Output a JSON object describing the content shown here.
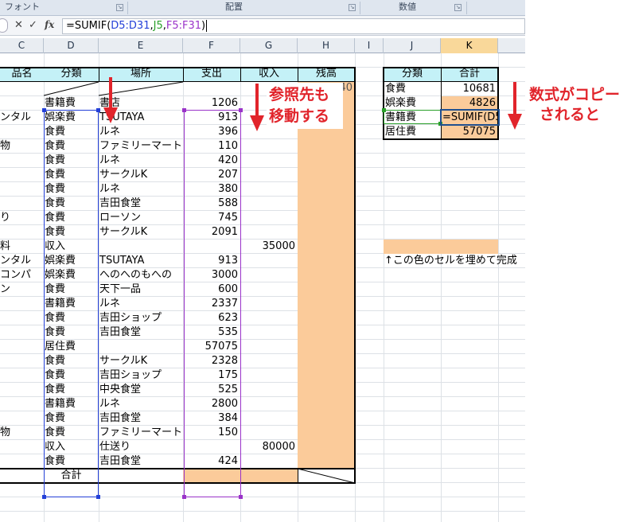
{
  "ribbon": {
    "groups": [
      {
        "label": "フォント"
      },
      {
        "label": "配置"
      },
      {
        "label": "数値"
      }
    ]
  },
  "formula_bar": {
    "cancel": "✕",
    "enter": "✓",
    "fx": "fx",
    "formula": {
      "prefix": "=SUMIF(",
      "arg1": "D5:D31",
      "sep1": ",",
      "arg2": "J5",
      "sep2": ",",
      "arg3": "F5:F31",
      "suffix": ")"
    }
  },
  "columns": [
    "C",
    "D",
    "E",
    "F",
    "G",
    "H",
    "I",
    "J",
    "K"
  ],
  "table": {
    "headers": [
      "品名",
      "分類",
      "場所",
      "支出",
      "収入",
      "残高"
    ],
    "balance_first": "75240",
    "rows": [
      {
        "name": "",
        "cat": "書籍費",
        "place": "書店",
        "out": "1206",
        "in": ""
      },
      {
        "name": "ンタル",
        "cat": "娯楽費",
        "place": "TSUTAYA",
        "out": "913",
        "in": ""
      },
      {
        "name": "",
        "cat": "食費",
        "place": "ルネ",
        "out": "396",
        "in": ""
      },
      {
        "name": "物",
        "cat": "食費",
        "place": "ファミリーマート",
        "out": "110",
        "in": ""
      },
      {
        "name": "",
        "cat": "食費",
        "place": "ルネ",
        "out": "420",
        "in": ""
      },
      {
        "name": "",
        "cat": "食費",
        "place": "サークルK",
        "out": "207",
        "in": ""
      },
      {
        "name": "",
        "cat": "食費",
        "place": "ルネ",
        "out": "380",
        "in": ""
      },
      {
        "name": "",
        "cat": "食費",
        "place": "吉田食堂",
        "out": "588",
        "in": ""
      },
      {
        "name": "り",
        "cat": "食費",
        "place": "ローソン",
        "out": "745",
        "in": ""
      },
      {
        "name": "",
        "cat": "食費",
        "place": "サークルK",
        "out": "2091",
        "in": ""
      },
      {
        "name": "料",
        "cat": "収入",
        "place": "",
        "out": "",
        "in": "35000"
      },
      {
        "name": "ンタル",
        "cat": "娯楽費",
        "place": "TSUTAYA",
        "out": "913",
        "in": ""
      },
      {
        "name": "コンパ",
        "cat": "娯楽費",
        "place": "へのへのもへの",
        "out": "3000",
        "in": ""
      },
      {
        "name": "ン",
        "cat": "食費",
        "place": "天下一品",
        "out": "600",
        "in": ""
      },
      {
        "name": "",
        "cat": "書籍費",
        "place": "ルネ",
        "out": "2337",
        "in": ""
      },
      {
        "name": "",
        "cat": "食費",
        "place": "吉田ショップ",
        "out": "623",
        "in": ""
      },
      {
        "name": "",
        "cat": "食費",
        "place": "吉田食堂",
        "out": "535",
        "in": ""
      },
      {
        "name": "",
        "cat": "居住費",
        "place": "",
        "out": "57075",
        "in": ""
      },
      {
        "name": "",
        "cat": "食費",
        "place": "サークルK",
        "out": "2328",
        "in": ""
      },
      {
        "name": "",
        "cat": "食費",
        "place": "吉田ショップ",
        "out": "175",
        "in": ""
      },
      {
        "name": "",
        "cat": "食費",
        "place": "中央食堂",
        "out": "525",
        "in": ""
      },
      {
        "name": "",
        "cat": "書籍費",
        "place": "ルネ",
        "out": "2800",
        "in": ""
      },
      {
        "name": "",
        "cat": "食費",
        "place": "吉田食堂",
        "out": "384",
        "in": ""
      },
      {
        "name": "物",
        "cat": "食費",
        "place": "ファミリーマート",
        "out": "150",
        "in": ""
      },
      {
        "name": "",
        "cat": "収入",
        "place": "仕送り",
        "out": "",
        "in": "80000"
      },
      {
        "name": "",
        "cat": "食費",
        "place": "吉田食堂",
        "out": "424",
        "in": ""
      }
    ],
    "total_label": "合計"
  },
  "summary": {
    "headers": [
      "分類",
      "合計"
    ],
    "rows": [
      {
        "cat": "食費",
        "total": "10681"
      },
      {
        "cat": "娯楽費",
        "total": "4826"
      },
      {
        "cat": "書籍費",
        "total": "=SUMIF(D5"
      },
      {
        "cat": "居住費",
        "total": "57075"
      }
    ]
  },
  "note": "↑この色のセルを埋めて完成",
  "annotations": {
    "ref_moves": [
      "参照先も",
      "移動する"
    ],
    "copy_formula": [
      "数式がコピー",
      "されると"
    ]
  },
  "colors": {
    "accent_red": "#e1242b",
    "fill_orange": "#fbcb9a",
    "header_cyan": "#c4f1f7",
    "ref_blue": "#2440d8",
    "ref_green": "#2aa02a",
    "ref_purple": "#9a33c9"
  }
}
